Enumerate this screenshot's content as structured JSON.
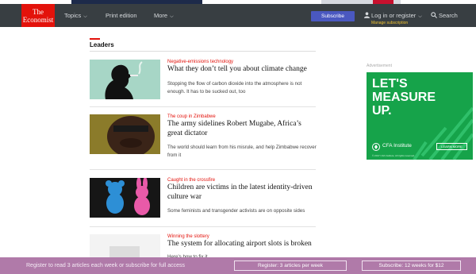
{
  "header": {
    "logo_line1": "The",
    "logo_line2": "Economist",
    "nav": [
      {
        "label": "Topics"
      },
      {
        "label": "Print edition"
      },
      {
        "label": "More"
      }
    ],
    "subscribe_label": "Subscribe",
    "login_label": "Log in or register",
    "manage_label": "Manage subscription",
    "search_label": "Search"
  },
  "section": {
    "title": "Leaders"
  },
  "articles": [
    {
      "flytitle": "Negative-emissions technology",
      "headline": "What they don’t tell you about climate change",
      "description": "Stopping the flow of carbon dioxide into the atmosphere is not enough. It has to be sucked out, too"
    },
    {
      "flytitle": "The coup in Zimbabwe",
      "headline": "The army sidelines Robert Mugabe, Africa’s great dictator",
      "description": "The world should learn from his misrule, and help Zimbabwe recover from it"
    },
    {
      "flytitle": "Caught in the crossfire",
      "headline": "Children are victims in the latest identity-driven culture war",
      "description": "Some feminists and transgender activists are on opposite sides"
    },
    {
      "flytitle": "Winning the slottery",
      "headline": "The system for allocating airport slots is broken",
      "description": "Here’s how to fix it"
    }
  ],
  "ad": {
    "label": "Advertisement",
    "line1": "LET'S",
    "line2": "MEASURE",
    "line3": "UP.",
    "brand": "CFA Institute",
    "cta": "LEARN MORE",
    "fine": "© 2017 CFA Institute. All rights reserved."
  },
  "footer": {
    "message": "Register to read 3 articles each week or subscribe for full access",
    "register_label": "Register: 3 articles per week",
    "subscribe_label": "Subscribe: 12 weeks for $12"
  },
  "colors": {
    "brand_red": "#e3120b",
    "header_bg": "#383e42",
    "subscribe_blue": "#4a58c0",
    "footer_bg": "#b07aa9",
    "ad_green": "#16a34a"
  }
}
